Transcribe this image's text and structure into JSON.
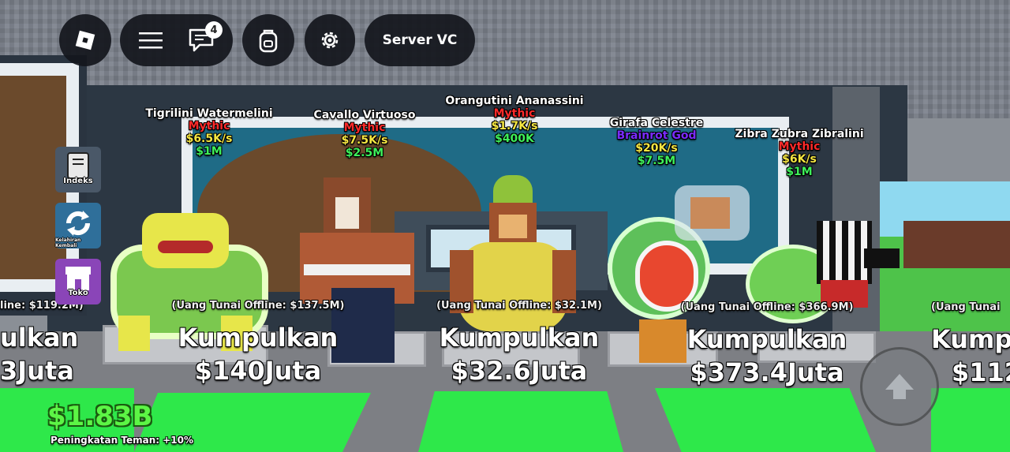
{
  "topbar": {
    "chat_badge": "4",
    "server_vc_label": "Server VC"
  },
  "side_menu": {
    "index_label": "Indeks",
    "rebirth_label": "Kelahiran Kembali",
    "shop_label": "Toko"
  },
  "brainrots": [
    {
      "name": "Tigrilini Watermelini",
      "rarity": "Mythic",
      "rarity_color": "#ff2a2a",
      "rate": "$6.5K/s",
      "price": "$1M"
    },
    {
      "name": "Cavallo Virtuoso",
      "rarity": "Mythic",
      "rarity_color": "#ff2a2a",
      "rate": "$7.5K/s",
      "price": "$2.5M"
    },
    {
      "name": "Orangutini Ananassini",
      "rarity": "Mythic",
      "rarity_color": "#ff2a2a",
      "rate": "$1.7K/s",
      "price": "$400K"
    },
    {
      "name": "Girafa Celestre",
      "rarity": "Brainrot God",
      "rarity_color": "#7a2cff",
      "rate": "$20K/s",
      "price": "$7.5M"
    },
    {
      "name": "Zibra Zubra Zibralini",
      "rarity": "Mythic",
      "rarity_color": "#ff2a2a",
      "rate": "$6K/s",
      "price": "$1M"
    }
  ],
  "collectors": [
    {
      "offline": "line: $119.2M)",
      "collect": "ulkan",
      "amount": "3Juta"
    },
    {
      "offline": "(Uang Tunai Offline: $137.5M)",
      "collect": "Kumpulkan",
      "amount": "$140Juta"
    },
    {
      "offline": "(Uang Tunai Offline: $32.1M)",
      "collect": "Kumpulkan",
      "amount": "$32.6Juta"
    },
    {
      "offline": "(Uang Tunai Offline: $366.9M)",
      "collect": "Kumpulkan",
      "amount": "$373.4Juta"
    },
    {
      "offline": "(Uang Tunai",
      "collect": "Kump",
      "amount": "$112"
    }
  ],
  "player": {
    "money": "$1.83B",
    "boost": "Peningkatan Teman: +10%"
  },
  "colors": {
    "accent_green": "#2ee84a",
    "money_green": "#5cf545",
    "rate_yellow": "#f5e642"
  }
}
